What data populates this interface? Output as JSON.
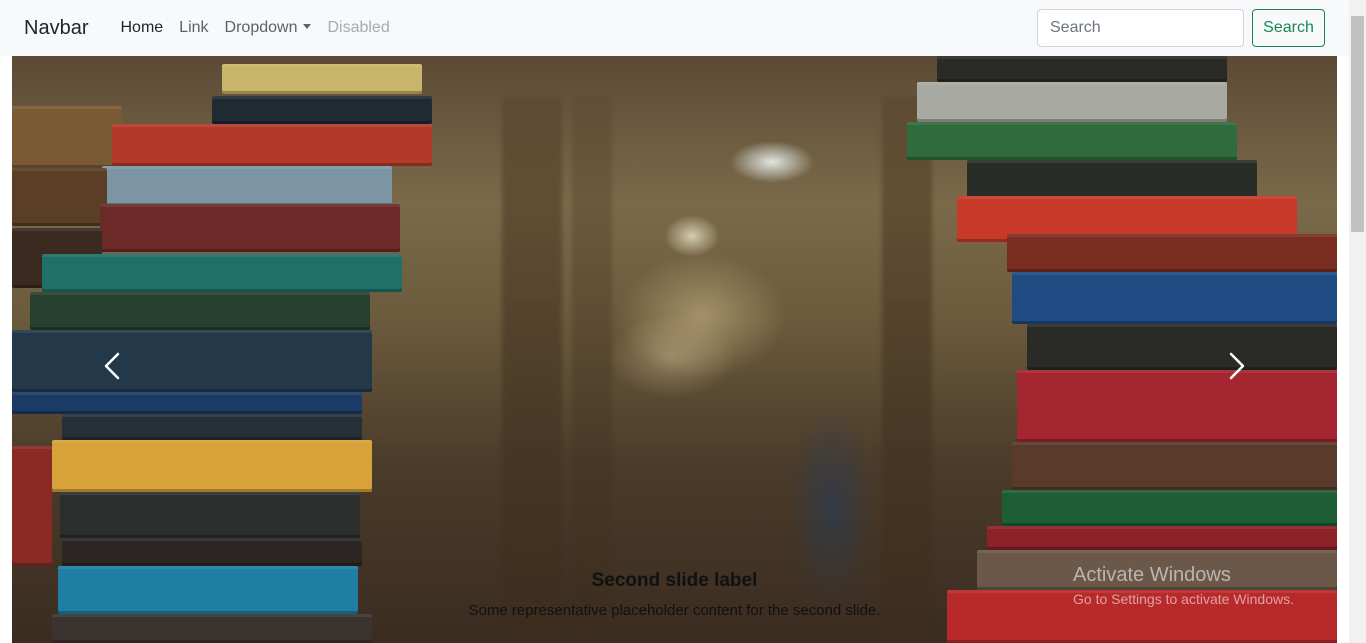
{
  "navbar": {
    "brand": "Navbar",
    "links": [
      {
        "label": "Home",
        "state": "active"
      },
      {
        "label": "Link",
        "state": "normal"
      },
      {
        "label": "Dropdown",
        "state": "dropdown"
      },
      {
        "label": "Disabled",
        "state": "disabled"
      }
    ],
    "search": {
      "placeholder": "Search",
      "button_label": "Search"
    }
  },
  "carousel": {
    "caption": {
      "title": "Second slide label",
      "text": "Some representative placeholder content for the second slide."
    },
    "controls": {
      "prev_icon": "chevron-left-icon",
      "next_icon": "chevron-right-icon"
    }
  },
  "watermark": {
    "title": "Activate Windows",
    "text": "Go to Settings to activate Windows."
  },
  "colors": {
    "navbar_bg": "#f8f9fa",
    "success": "#198754",
    "disabled": "#a6abb0"
  }
}
